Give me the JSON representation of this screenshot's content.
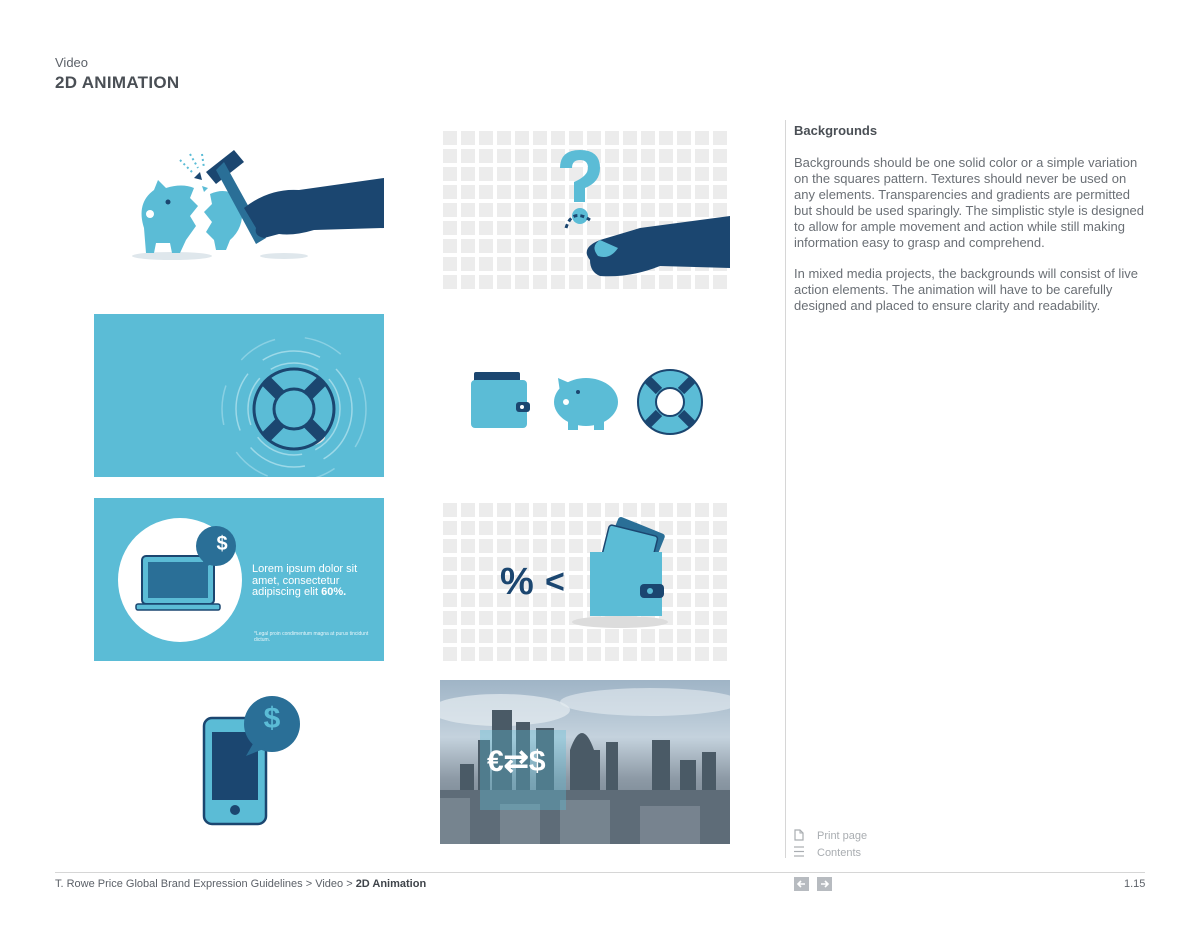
{
  "header": {
    "section": "Video",
    "title": "2D ANIMATION"
  },
  "sidebar": {
    "title": "Backgrounds",
    "paragraph1": "Backgrounds should be one solid color or a simple variation on the squares pattern. Textures should never be used on any elements. Transparencies and gradients are permitted but should be used sparingly. The simplistic style is designed to allow for ample movement and action while still making information easy to grasp and comprehend.",
    "paragraph2": "In mixed media projects, the backgrounds will consist of live action elements. The animation will have to be carefully designed and placed to ensure clarity and readability.",
    "print_label": "Print page",
    "contents_label": "Contents"
  },
  "frames": {
    "laptop": {
      "text": "Lorem ipsum dolor sit amet, consectetur adipiscing elit ",
      "highlight": "60%.",
      "fine_print": "*Legal proin condimentum magna at purus tincidunt dictum."
    },
    "compare": {
      "percent": "%",
      "less_than": "<"
    },
    "city": {
      "currency": "€⇄$"
    },
    "dollar": "$"
  },
  "footer": {
    "crumb1": "T. Rowe Price Global Brand Expression Guidelines",
    "sep": ">",
    "crumb2": "Video",
    "crumb3": "2D Animation",
    "page": "1.15"
  },
  "colors": {
    "light_blue": "#5bbcd6",
    "navy": "#1b4670",
    "mid_blue": "#2a6f97",
    "grid_bg": "#ececec"
  },
  "icons": [
    "document-icon",
    "list-icon",
    "arrow-left-icon",
    "arrow-right-icon"
  ]
}
